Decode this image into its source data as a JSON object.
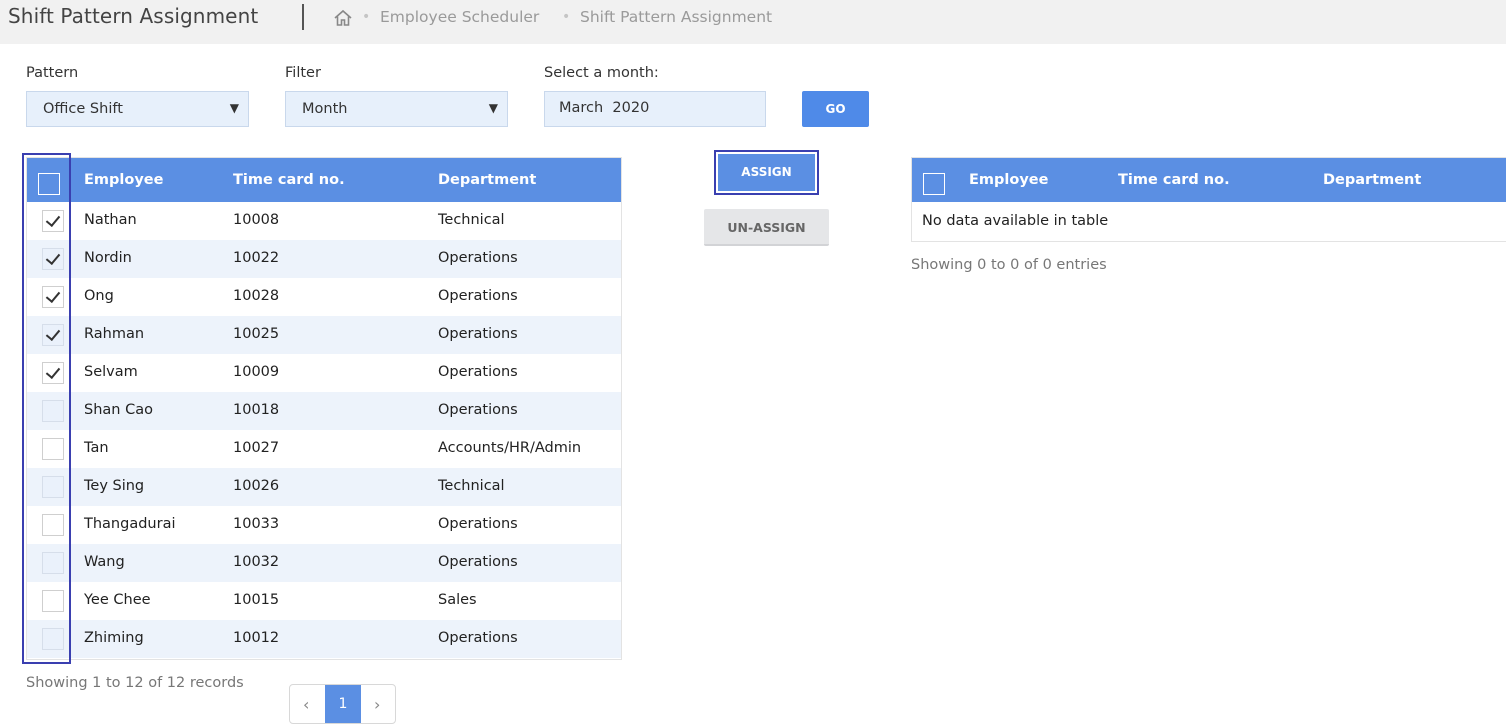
{
  "header": {
    "title": "Shift Pattern Assignment",
    "breadcrumb": [
      "Employee Scheduler",
      "Shift Pattern Assignment"
    ],
    "home_icon": "home-icon"
  },
  "filters": {
    "pattern_label": "Pattern",
    "pattern_value": "Office Shift",
    "filter_label": "Filter",
    "filter_value": "Month",
    "month_label": "Select a month:",
    "month_value": "March  2020",
    "go_label": "GO"
  },
  "left_table": {
    "columns": [
      "Employee",
      "Time card no.",
      "Department"
    ],
    "rows": [
      {
        "employee": "Nathan",
        "timecard": "10008",
        "department": "Technical",
        "checked": true
      },
      {
        "employee": "Nordin",
        "timecard": "10022",
        "department": "Operations",
        "checked": true
      },
      {
        "employee": "Ong",
        "timecard": "10028",
        "department": "Operations",
        "checked": true
      },
      {
        "employee": "Rahman",
        "timecard": "10025",
        "department": "Operations",
        "checked": true
      },
      {
        "employee": "Selvam",
        "timecard": "10009",
        "department": "Operations",
        "checked": true
      },
      {
        "employee": "Shan Cao",
        "timecard": "10018",
        "department": "Operations",
        "checked": false
      },
      {
        "employee": "Tan",
        "timecard": "10027",
        "department": "Accounts/HR/Admin",
        "checked": false
      },
      {
        "employee": "Tey Sing",
        "timecard": "10026",
        "department": "Technical",
        "checked": false
      },
      {
        "employee": "Thangadurai",
        "timecard": "10033",
        "department": "Operations",
        "checked": false
      },
      {
        "employee": "Wang",
        "timecard": "10032",
        "department": "Operations",
        "checked": false
      },
      {
        "employee": "Yee Chee",
        "timecard": "10015",
        "department": "Sales",
        "checked": false
      },
      {
        "employee": "Zhiming",
        "timecard": "10012",
        "department": "Operations",
        "checked": false
      }
    ],
    "footer": "Showing 1 to 12 of 12 records",
    "pagination": {
      "prev": "‹",
      "current": "1",
      "next": "›"
    }
  },
  "actions": {
    "assign_label": "ASSIGN",
    "unassign_label": "UN-ASSIGN"
  },
  "right_table": {
    "columns": [
      "Employee",
      "Time card no.",
      "Department"
    ],
    "empty_text": "No data available in table",
    "footer": "Showing 0 to 0 of 0 entries"
  },
  "colors": {
    "accent": "#5b8fe3",
    "highlight": "#3a3fb0"
  }
}
